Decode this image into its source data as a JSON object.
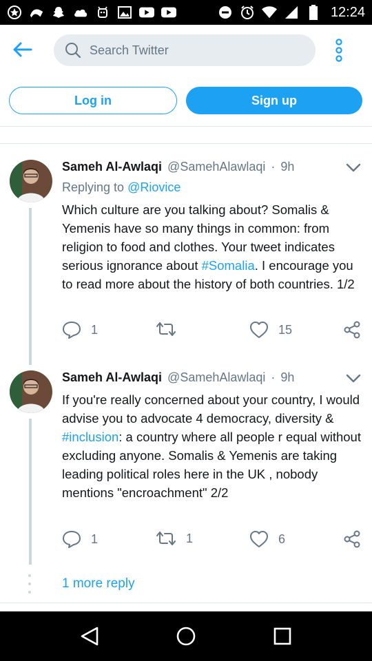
{
  "status_bar": {
    "time": "12:24",
    "left_icons": [
      "star-badge-icon",
      "android-pay-icon",
      "snapchat-icon",
      "cloud-icon",
      "android-icon",
      "image-icon",
      "youtube-icon",
      "youtube-icon"
    ],
    "right_icons": [
      "do-not-disturb-icon",
      "alarm-icon",
      "wifi-icon",
      "signal-icon",
      "battery-icon"
    ]
  },
  "header": {
    "search_placeholder": "Search Twitter"
  },
  "auth": {
    "login_label": "Log in",
    "signup_label": "Sign up"
  },
  "tweets": [
    {
      "name": "Sameh Al-Awlaqi",
      "handle": "@SamehAlawlaqi",
      "dot": "·",
      "time": "9h",
      "replying_prefix": "Replying to",
      "replying_to": "@Riovice",
      "body_before": "Which culture are you talking about? Somalis & Yemenis have so many things in common: from religion to food and clothes. Your tweet indicates serious ignorance about ",
      "hashtag": "#Somalia",
      "body_after": ". I encourage you to read more about the history of both countries. 1/2",
      "replies": "1",
      "retweets": "",
      "likes": "15"
    },
    {
      "name": "Sameh Al-Awlaqi",
      "handle": "@SamehAlawlaqi",
      "dot": "·",
      "time": "9h",
      "body_before": "If you're really concerned about your country, I would advise you to advocate 4 democracy, diversity & ",
      "hashtag": "#inclusion",
      "body_after": ": a country where all people r equal without excluding anyone. Somalis & Yemenis are taking leading political roles here in the UK , nobody mentions \"encroachment\" 2/2",
      "replies": "1",
      "retweets": "1",
      "likes": "6"
    }
  ],
  "more_replies": "1 more reply",
  "colors": {
    "accent": "#1da1f2",
    "muted": "#657786",
    "text": "#14171a",
    "border": "#e1e8ed"
  }
}
